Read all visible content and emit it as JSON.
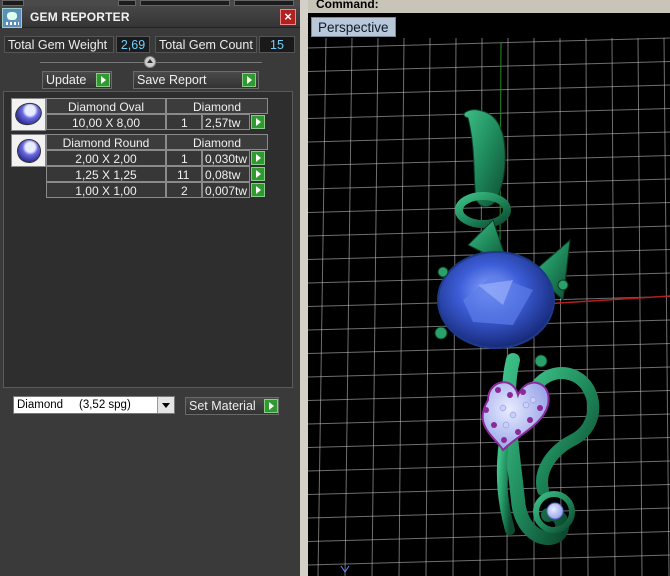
{
  "panel": {
    "title": "GEM REPORTER",
    "close_glyph": "×",
    "total_weight_label": "Total Gem Weight",
    "total_weight_value": "2,69",
    "total_count_label": "Total Gem Count",
    "total_count_value": "15",
    "update_label": "Update",
    "save_report_label": "Save Report"
  },
  "gems": {
    "oval": {
      "name": "Diamond Oval",
      "material": "Diamond",
      "rows": [
        {
          "size": "10,00 X 8,00",
          "count": "1",
          "weight": "2,57tw"
        }
      ]
    },
    "round": {
      "name": "Diamond Round",
      "material": "Diamond",
      "rows": [
        {
          "size": "2,00 X 2,00",
          "count": "1",
          "weight": "0,030tw"
        },
        {
          "size": "1,25 X 1,25",
          "count": "11",
          "weight": "0,08tw"
        },
        {
          "size": "1,00 X 1,00",
          "count": "2",
          "weight": "0,007tw"
        }
      ]
    }
  },
  "material": {
    "selected": "Diamond     (3,52 spg)",
    "set_material_label": "Set Material"
  },
  "viewport": {
    "command_text": "Command:",
    "view_name": "Perspective"
  },
  "colors": {
    "metal_green": "#1f8a5c",
    "stone_blue": "#3a5bd0",
    "amethyst": "#8a2a9a",
    "grid_line": "#c8c8c8",
    "x_axis": "#b02020",
    "go_green": "#2f9a2f"
  },
  "icons": {
    "title": "gem-reporter-icon",
    "close": "close-icon",
    "go": "arrow-right-icon",
    "collapse": "collapse-icon",
    "dropdown": "chevron-down-icon"
  }
}
